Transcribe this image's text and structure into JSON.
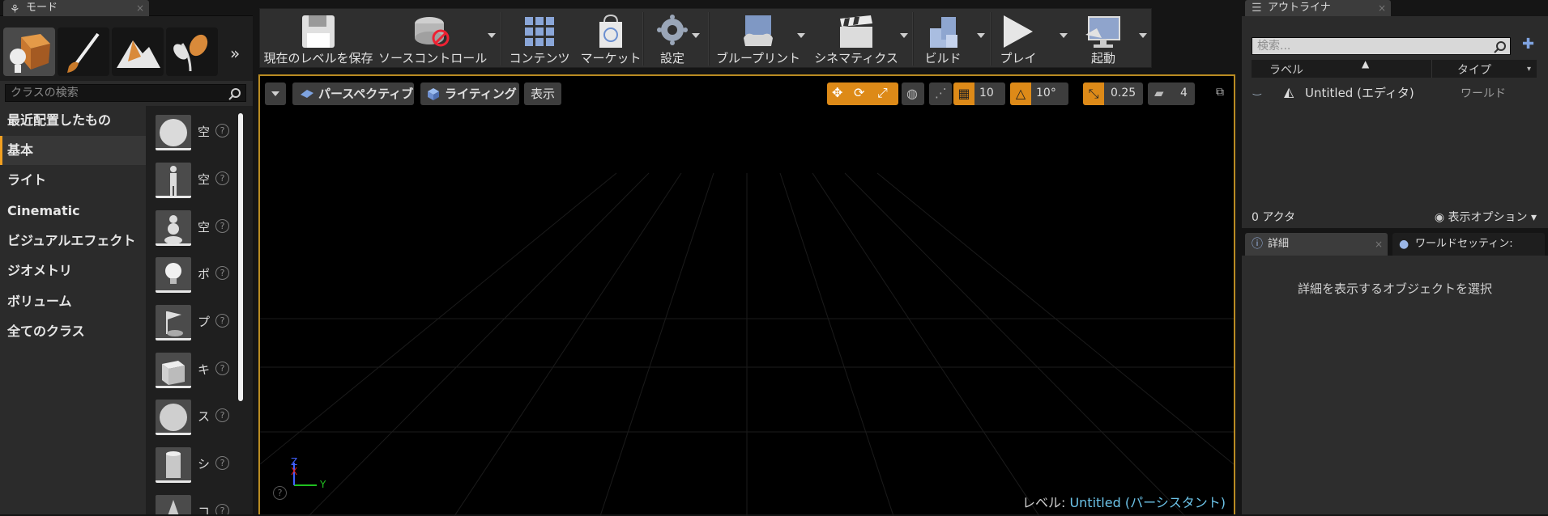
{
  "modes_panel": {
    "tab_title": "モード",
    "search_placeholder": "クラスの検索",
    "categories": [
      "最近配置したもの",
      "基本",
      "ライト",
      "Cinematic",
      "ビジュアルエフェクト",
      "ジオメトリ",
      "ボリューム",
      "全てのクラス"
    ],
    "placeables": [
      "空",
      "空",
      "空",
      "ポ",
      "プ",
      "キ",
      "ス",
      "シ",
      "コ"
    ],
    "help_glyph": "?",
    "more_glyph": "»"
  },
  "toolbar": {
    "buttons": [
      "現在のレベルを保存",
      "ソースコントロール",
      "コンテンツ",
      "マーケット",
      "設定",
      "ブループリント",
      "シネマティクス",
      "ビルド",
      "プレイ",
      "起動"
    ]
  },
  "viewport": {
    "perspective_label": "パースペクティブ",
    "lighting_label": "ライティング",
    "show_label": "表示",
    "grid_snap": "10",
    "rotation_snap": "10°",
    "scale_snap": "0.25",
    "camera_speed": "4",
    "level_prefix": "レベル:",
    "level_name": "Untitled (パーシスタント)",
    "axis": {
      "z": "Z",
      "x": "X",
      "y": "Y"
    },
    "help_glyph": "?"
  },
  "outliner": {
    "tab_title": "アウトライナ",
    "search_placeholder": "検索...",
    "col_label": "ラベル",
    "col_type": "タイプ",
    "rows": [
      {
        "label": "Untitled (エディタ)",
        "type": "ワールド"
      }
    ],
    "actor_count": "0 アクタ",
    "view_options": "表示オプション"
  },
  "details": {
    "tab_title": "詳細",
    "world_settings_tab": "ワールドセッティン:",
    "empty_message": "詳細を表示するオブジェクトを選択"
  },
  "colors": {
    "accent_orange": "#dd8a18",
    "viewport_border": "#b98b22",
    "level_name_color": "#6cc3e8",
    "axis_x": "#e02020",
    "axis_y": "#20c020",
    "axis_z": "#4060ff"
  }
}
